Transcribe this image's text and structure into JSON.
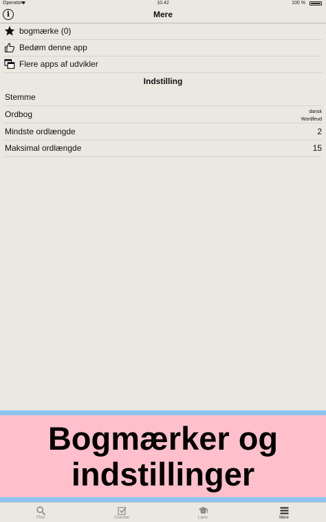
{
  "status_bar": {
    "carrier": "Operator",
    "time": "10.42",
    "battery": "100 %"
  },
  "nav": {
    "title": "Mere"
  },
  "menu": {
    "bookmarks": "bogmærke (0)",
    "rate": "Bedøm denne app",
    "more_apps": "Flere apps af udvikler"
  },
  "settings": {
    "header": "Indstilling",
    "voice": {
      "label": "Stemme"
    },
    "dictionary": {
      "label": "Ordbog",
      "value_line1": "dansk",
      "value_line2": "Wordfeud"
    },
    "min_length": {
      "label": "Mindste ordlængde",
      "value": "2"
    },
    "max_length": {
      "label": "Maksimal ordlængde",
      "value": "15"
    }
  },
  "banner": {
    "line1": "Bogmærker og",
    "line2": "indstillinger"
  },
  "tabs": {
    "find": "Find",
    "checker": "Checker",
    "learn": "Lære",
    "more": "Mere"
  },
  "colors": {
    "background": "#ebe7e1",
    "banner_pink": "#ffc0cb",
    "banner_border_blue": "#8fc4ef"
  }
}
